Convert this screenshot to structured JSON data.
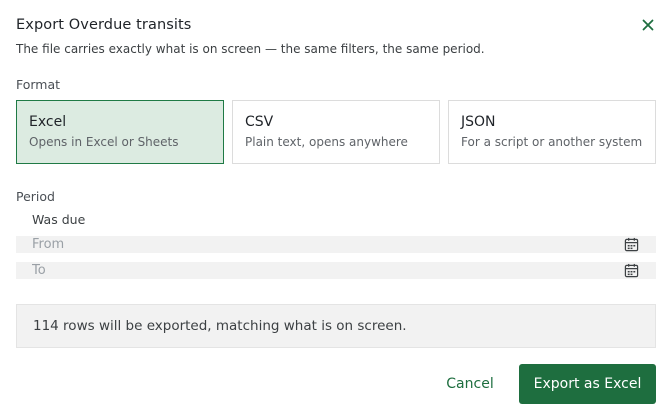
{
  "dialog": {
    "title": "Export Overdue transits",
    "subtitle": "The file carries exactly what is on screen — the same filters, the same period.",
    "close_icon": "close-icon"
  },
  "format": {
    "label": "Format",
    "selected": "Excel",
    "options": [
      {
        "name": "Excel",
        "description": "Opens in Excel or Sheets"
      },
      {
        "name": "CSV",
        "description": "Plain text, opens anywhere"
      },
      {
        "name": "JSON",
        "description": "For a script or another system"
      }
    ]
  },
  "period": {
    "label": "Period",
    "sub_label": "Was due",
    "from": {
      "value": "",
      "placeholder": "From",
      "icon": "calendar-icon"
    },
    "to": {
      "value": "",
      "placeholder": "To",
      "icon": "calendar-icon"
    }
  },
  "summary": {
    "text": "114 rows will be exported, matching what is on screen."
  },
  "actions": {
    "cancel_label": "Cancel",
    "export_label": "Export as Excel"
  },
  "colors": {
    "accent": "#1e6e3f",
    "selected_card_bg": "#dcebe1",
    "field_bg": "#f2f2f2"
  }
}
